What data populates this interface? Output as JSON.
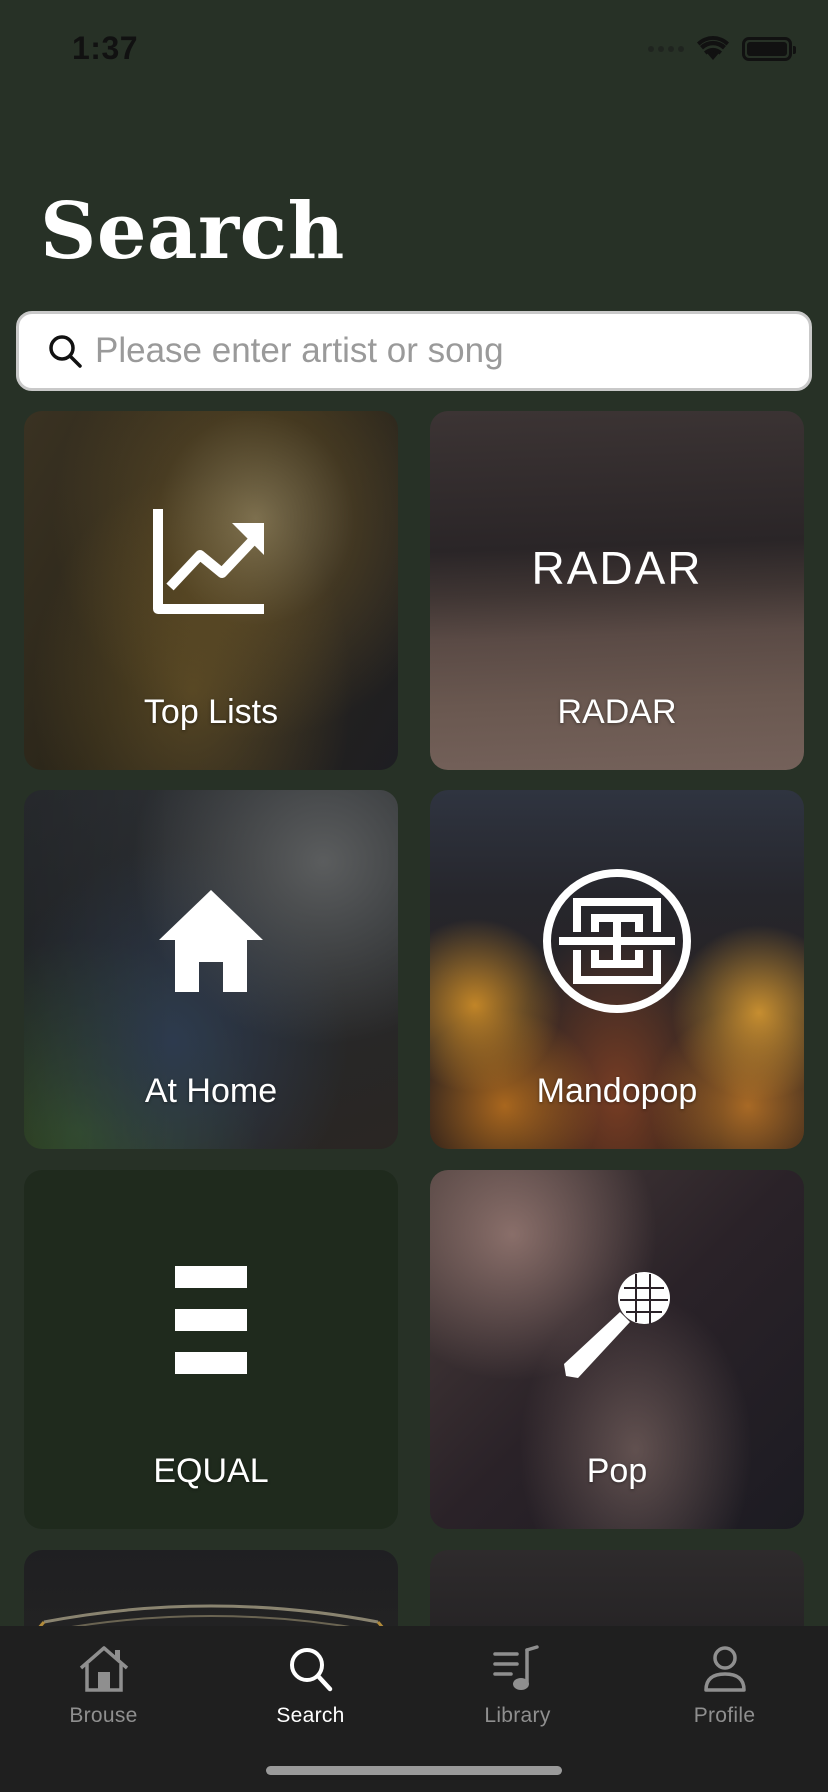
{
  "status": {
    "time": "1:37"
  },
  "page": {
    "title": "Search"
  },
  "search": {
    "placeholder": "Please enter artist or song",
    "value": ""
  },
  "tiles": [
    {
      "label": "Top Lists",
      "icon": "chart-trend-icon"
    },
    {
      "label": "RADAR",
      "logo_text": "RADAR",
      "icon": "radar-logo"
    },
    {
      "label": "At Home",
      "icon": "house-icon"
    },
    {
      "label": "Mandopop",
      "icon": "chinese-knot-icon"
    },
    {
      "label": "EQUAL",
      "icon": "equal-bars-icon"
    },
    {
      "label": "Pop",
      "icon": "microphone-icon"
    }
  ],
  "tabs": [
    {
      "label": "Brouse",
      "icon": "home-icon",
      "active": false
    },
    {
      "label": "Search",
      "icon": "search-icon",
      "active": true
    },
    {
      "label": "Library",
      "icon": "library-icon",
      "active": false
    },
    {
      "label": "Profile",
      "icon": "person-icon",
      "active": false
    }
  ],
  "colors": {
    "background": "#273126",
    "tab_bar": "#1f1f1f",
    "tab_active": "#ffffff",
    "tab_inactive": "#8f8f8f",
    "equal_tile": "#1f2a1d"
  }
}
